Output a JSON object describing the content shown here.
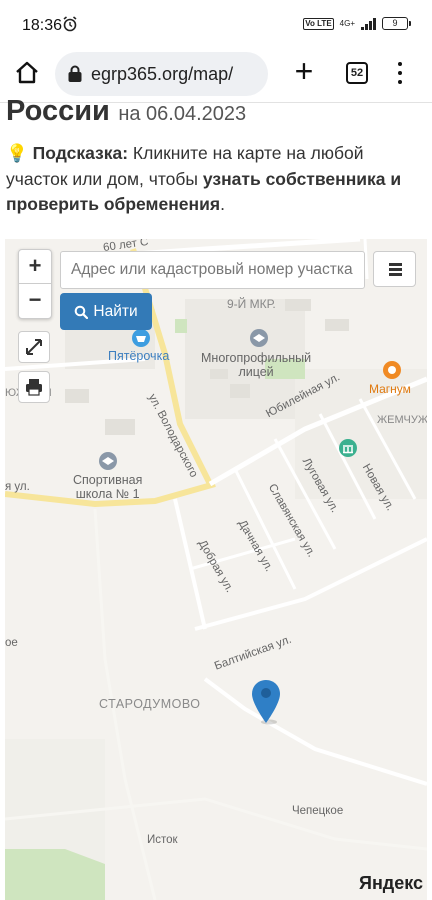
{
  "status_bar": {
    "time": "18:36",
    "volte": "Vo LTE",
    "net_type": "4G+",
    "battery": "9"
  },
  "browser": {
    "url": "egrp365.org/map/",
    "tab_count": "52"
  },
  "page": {
    "title": "России",
    "date_text": "на 06.04.2023",
    "hint_emoji": "💡",
    "hint_label": "Подсказка:",
    "hint_text": " Кликните на карте на любой участок или дом, чтобы ",
    "hint_bold": "узнать собственника и проверить обременения",
    "hint_end": "."
  },
  "map": {
    "search_placeholder": "Адрес или кадастровый номер участка",
    "find_label": "Найти",
    "zoom_in": "+",
    "zoom_out": "−",
    "attribution": "Яндекс",
    "labels": {
      "street_60let": "60 лет С",
      "mkr9": "9-Й МКР.",
      "pyaterochka": "Пятёрочка",
      "lyceum": "Многопрофильный\nлицей",
      "magnum": "Магнум",
      "zhemchug": "ЖЕМЧУЖ",
      "yubileynaya": "Юбилейная ул.",
      "volodarskogo": "ул. Володарского",
      "lugovaya": "Луговая ул.",
      "novaya": "Новая ул.",
      "sport_school": "Спортивная\nшкола № 1",
      "slavyanskaya": "Славянская ул.",
      "dachnaya": "Дачная ул.",
      "dobraya": "Добрая ул.",
      "baltiyskaya": "Балтийская ул.",
      "starodumovo": "СТАРОДУМОВО",
      "chetseskoe": "Чепецкое",
      "istok": "Исток",
      "yuzhny": "ЮЖНЫЙ",
      "ul_left": "я ул.",
      "oe": "ое"
    }
  }
}
